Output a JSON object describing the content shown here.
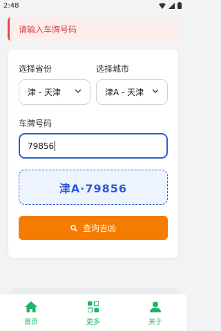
{
  "status_bar": {
    "time": "2:48"
  },
  "alert": {
    "message": "请输入车牌号码"
  },
  "form": {
    "province_label": "选择省份",
    "province_value": "津 - 天津",
    "city_label": "选择城市",
    "city_value": "津A - 天津",
    "plate_label": "车牌号码",
    "plate_value": "79856",
    "preview_plate": "津A·79856",
    "query_button": "查询吉凶"
  },
  "tabs": [
    {
      "label": "首页",
      "icon": "home-icon"
    },
    {
      "label": "更多",
      "icon": "apps-icon"
    },
    {
      "label": "关于",
      "icon": "person-icon"
    }
  ],
  "colors": {
    "accent_blue": "#2a5bd7",
    "button_orange": "#f57c00",
    "tab_green": "#1fb36b",
    "alert_red": "#e34848"
  }
}
